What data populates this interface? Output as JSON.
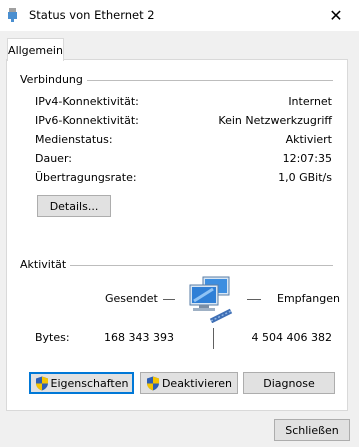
{
  "window": {
    "title": "Status von Ethernet 2",
    "close_glyph": "✕"
  },
  "tabs": [
    {
      "label": "Allgemein",
      "active": true
    }
  ],
  "connection": {
    "group_label": "Verbindung",
    "rows": [
      {
        "label": "IPv4-Konnektivität:",
        "value": "Internet"
      },
      {
        "label": "IPv6-Konnektivität:",
        "value": "Kein Netzwerkzugriff"
      },
      {
        "label": "Medienstatus:",
        "value": "Aktiviert"
      },
      {
        "label": "Dauer:",
        "value": "12:07:35"
      },
      {
        "label": "Übertragungsrate:",
        "value": "1,0 GBit/s"
      }
    ],
    "details_button": "Details..."
  },
  "activity": {
    "group_label": "Aktivität",
    "sent_label": "Gesendet",
    "received_label": "Empfangen",
    "bytes_label": "Bytes:",
    "bytes_sent": "168 343 393",
    "bytes_received": "4 504 406 382",
    "icon": "network-computers-icon"
  },
  "buttons": {
    "properties": "Eigenschaften",
    "disable": "Deaktivieren",
    "diagnose": "Diagnose",
    "close": "Schließen"
  },
  "colors": {
    "accent": "#0078d7",
    "shield_blue": "#2f5fb3",
    "shield_yellow": "#f5c400"
  }
}
